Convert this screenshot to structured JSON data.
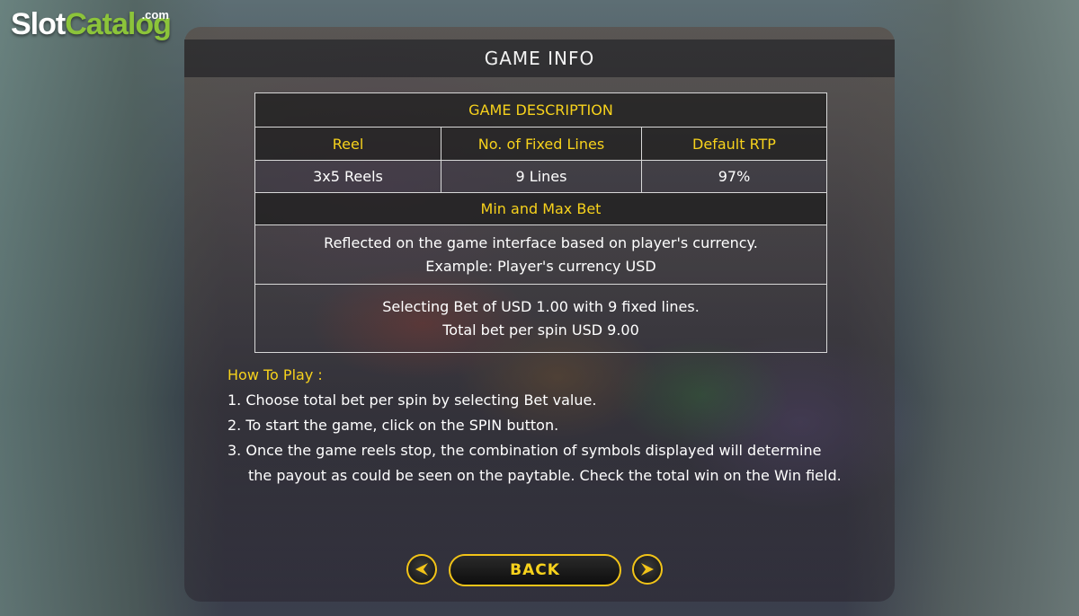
{
  "watermark": {
    "brand_slot": "Slot",
    "brand_catalog": "Catalog",
    "brand_com": ".com"
  },
  "title": "GAME INFO",
  "table": {
    "section_title": "GAME DESCRIPTION",
    "columns": [
      "Reel",
      "No. of Fixed Lines",
      "Default RTP"
    ],
    "values": [
      "3x5 Reels",
      "9 Lines",
      "97%"
    ],
    "bet_title": "Min and Max Bet",
    "bet_note_line1": "Reflected on the game interface based on player's currency.",
    "bet_note_line2": "Example: Player's currency USD",
    "bet_example_line1": "Selecting Bet of USD 1.00 with 9 fixed lines.",
    "bet_example_line2": "Total bet per spin USD 9.00"
  },
  "how_to_play": {
    "title": "How To Play :",
    "step1": "1. Choose total bet per spin by selecting Bet value.",
    "step2": "2. To start the game, click on the SPIN button.",
    "step3_line1": "3. Once the game reels stop, the combination of symbols displayed will determine",
    "step3_line2": "the payout as could be seen on the paytable. Check the total win on the Win field."
  },
  "nav": {
    "back_label": "BACK"
  },
  "colors": {
    "accent_yellow": "#f7d21c",
    "button_border": "#f2c418"
  },
  "icons": {
    "prev": "arrow-left-icon",
    "next": "arrow-right-icon"
  }
}
